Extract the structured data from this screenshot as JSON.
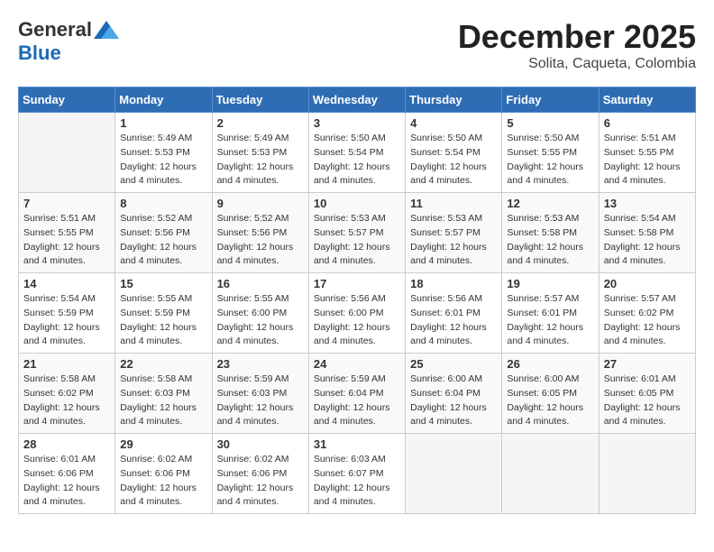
{
  "header": {
    "logo_general": "General",
    "logo_blue": "Blue",
    "month": "December 2025",
    "location": "Solita, Caqueta, Colombia"
  },
  "days_of_week": [
    "Sunday",
    "Monday",
    "Tuesday",
    "Wednesday",
    "Thursday",
    "Friday",
    "Saturday"
  ],
  "weeks": [
    [
      {
        "day": "",
        "info": ""
      },
      {
        "day": "1",
        "info": "Sunrise: 5:49 AM\nSunset: 5:53 PM\nDaylight: 12 hours\nand 4 minutes."
      },
      {
        "day": "2",
        "info": "Sunrise: 5:49 AM\nSunset: 5:53 PM\nDaylight: 12 hours\nand 4 minutes."
      },
      {
        "day": "3",
        "info": "Sunrise: 5:50 AM\nSunset: 5:54 PM\nDaylight: 12 hours\nand 4 minutes."
      },
      {
        "day": "4",
        "info": "Sunrise: 5:50 AM\nSunset: 5:54 PM\nDaylight: 12 hours\nand 4 minutes."
      },
      {
        "day": "5",
        "info": "Sunrise: 5:50 AM\nSunset: 5:55 PM\nDaylight: 12 hours\nand 4 minutes."
      },
      {
        "day": "6",
        "info": "Sunrise: 5:51 AM\nSunset: 5:55 PM\nDaylight: 12 hours\nand 4 minutes."
      }
    ],
    [
      {
        "day": "7",
        "info": "Sunrise: 5:51 AM\nSunset: 5:55 PM\nDaylight: 12 hours\nand 4 minutes."
      },
      {
        "day": "8",
        "info": "Sunrise: 5:52 AM\nSunset: 5:56 PM\nDaylight: 12 hours\nand 4 minutes."
      },
      {
        "day": "9",
        "info": "Sunrise: 5:52 AM\nSunset: 5:56 PM\nDaylight: 12 hours\nand 4 minutes."
      },
      {
        "day": "10",
        "info": "Sunrise: 5:53 AM\nSunset: 5:57 PM\nDaylight: 12 hours\nand 4 minutes."
      },
      {
        "day": "11",
        "info": "Sunrise: 5:53 AM\nSunset: 5:57 PM\nDaylight: 12 hours\nand 4 minutes."
      },
      {
        "day": "12",
        "info": "Sunrise: 5:53 AM\nSunset: 5:58 PM\nDaylight: 12 hours\nand 4 minutes."
      },
      {
        "day": "13",
        "info": "Sunrise: 5:54 AM\nSunset: 5:58 PM\nDaylight: 12 hours\nand 4 minutes."
      }
    ],
    [
      {
        "day": "14",
        "info": "Sunrise: 5:54 AM\nSunset: 5:59 PM\nDaylight: 12 hours\nand 4 minutes."
      },
      {
        "day": "15",
        "info": "Sunrise: 5:55 AM\nSunset: 5:59 PM\nDaylight: 12 hours\nand 4 minutes."
      },
      {
        "day": "16",
        "info": "Sunrise: 5:55 AM\nSunset: 6:00 PM\nDaylight: 12 hours\nand 4 minutes."
      },
      {
        "day": "17",
        "info": "Sunrise: 5:56 AM\nSunset: 6:00 PM\nDaylight: 12 hours\nand 4 minutes."
      },
      {
        "day": "18",
        "info": "Sunrise: 5:56 AM\nSunset: 6:01 PM\nDaylight: 12 hours\nand 4 minutes."
      },
      {
        "day": "19",
        "info": "Sunrise: 5:57 AM\nSunset: 6:01 PM\nDaylight: 12 hours\nand 4 minutes."
      },
      {
        "day": "20",
        "info": "Sunrise: 5:57 AM\nSunset: 6:02 PM\nDaylight: 12 hours\nand 4 minutes."
      }
    ],
    [
      {
        "day": "21",
        "info": "Sunrise: 5:58 AM\nSunset: 6:02 PM\nDaylight: 12 hours\nand 4 minutes."
      },
      {
        "day": "22",
        "info": "Sunrise: 5:58 AM\nSunset: 6:03 PM\nDaylight: 12 hours\nand 4 minutes."
      },
      {
        "day": "23",
        "info": "Sunrise: 5:59 AM\nSunset: 6:03 PM\nDaylight: 12 hours\nand 4 minutes."
      },
      {
        "day": "24",
        "info": "Sunrise: 5:59 AM\nSunset: 6:04 PM\nDaylight: 12 hours\nand 4 minutes."
      },
      {
        "day": "25",
        "info": "Sunrise: 6:00 AM\nSunset: 6:04 PM\nDaylight: 12 hours\nand 4 minutes."
      },
      {
        "day": "26",
        "info": "Sunrise: 6:00 AM\nSunset: 6:05 PM\nDaylight: 12 hours\nand 4 minutes."
      },
      {
        "day": "27",
        "info": "Sunrise: 6:01 AM\nSunset: 6:05 PM\nDaylight: 12 hours\nand 4 minutes."
      }
    ],
    [
      {
        "day": "28",
        "info": "Sunrise: 6:01 AM\nSunset: 6:06 PM\nDaylight: 12 hours\nand 4 minutes."
      },
      {
        "day": "29",
        "info": "Sunrise: 6:02 AM\nSunset: 6:06 PM\nDaylight: 12 hours\nand 4 minutes."
      },
      {
        "day": "30",
        "info": "Sunrise: 6:02 AM\nSunset: 6:06 PM\nDaylight: 12 hours\nand 4 minutes."
      },
      {
        "day": "31",
        "info": "Sunrise: 6:03 AM\nSunset: 6:07 PM\nDaylight: 12 hours\nand 4 minutes."
      },
      {
        "day": "",
        "info": ""
      },
      {
        "day": "",
        "info": ""
      },
      {
        "day": "",
        "info": ""
      }
    ]
  ]
}
